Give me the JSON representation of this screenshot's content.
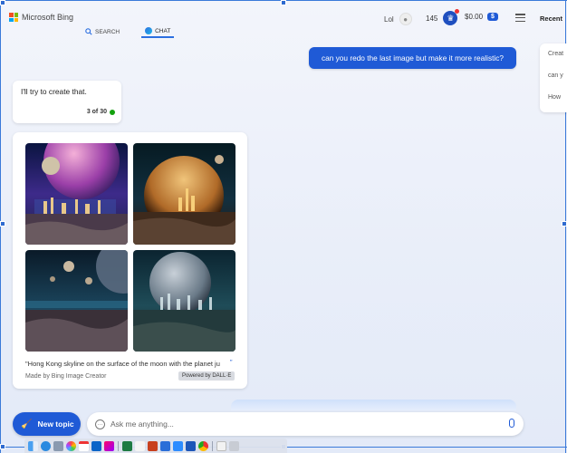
{
  "header": {
    "logo_text": "Microsoft Bing",
    "tabs": [
      {
        "label": "SEARCH",
        "icon": "search-icon"
      },
      {
        "label": "CHAT",
        "icon": "chat-icon"
      }
    ],
    "user_name": "Lol",
    "points": "145",
    "balance": "$0.00",
    "balance_badge": "$",
    "recent_title": "Recent"
  },
  "recent": {
    "items": [
      "Creat",
      "can y",
      "How"
    ]
  },
  "chat": {
    "user_message": "can you redo the last image but make it more realistic?",
    "bot_message": "I'll try to create that.",
    "bot_count": "3 of 30",
    "image_caption": "\"Hong Kong skyline on the surface of the moon with the planet ju",
    "made_by": "Made by Bing Image Creator",
    "powered_by": "Powered by DALL·E"
  },
  "composer": {
    "new_topic_label": "New topic",
    "placeholder": "Ask me anything..."
  },
  "colors": {
    "accent": "#1f5ad6",
    "status_green": "#13a10e"
  }
}
